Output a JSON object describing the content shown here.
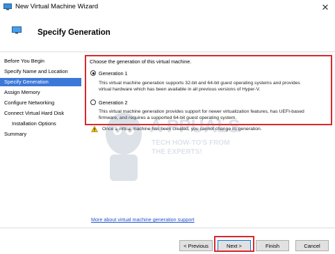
{
  "window": {
    "title": "New Virtual Machine Wizard",
    "close_glyph": "✕"
  },
  "header": {
    "title": "Specify Generation",
    "icon": "monitor-icon"
  },
  "nav": {
    "items": [
      {
        "label": "Before You Begin",
        "active": false
      },
      {
        "label": "Specify Name and Location",
        "active": false
      },
      {
        "label": "Specify Generation",
        "active": true
      },
      {
        "label": "Assign Memory",
        "active": false
      },
      {
        "label": "Configure Networking",
        "active": false
      },
      {
        "label": "Connect Virtual Hard Disk",
        "active": false
      },
      {
        "label": "Installation Options",
        "active": false,
        "sub": true
      },
      {
        "label": "Summary",
        "active": false
      }
    ]
  },
  "main": {
    "prompt": "Choose the generation of this virtual machine.",
    "options": [
      {
        "label": "Generation 1",
        "selected": true,
        "description_lines": [
          "This virtual machine generation supports 32-bit and 64-bit guest operating systems and provides",
          "virtual hardware which has been available in all previous versions of Hyper-V."
        ]
      },
      {
        "label": "Generation 2",
        "selected": false,
        "description_lines": [
          "This virtual machine generation provides support for newer virtualization features, has UEFI-based",
          "firmware, and requires a supported 64-bit guest operating system."
        ]
      }
    ],
    "warning": "Once a virtual machine has been created, you cannot change its generation.",
    "more_link": "More about virtual machine generation support"
  },
  "watermark": {
    "line1": "TECH HOW-TO'S FROM",
    "line2": "THE EXPERTS!"
  },
  "footer": {
    "previous_label": "< Previous",
    "next_label": "Next >",
    "finish_label": "Finish",
    "cancel_label": "Cancel"
  },
  "colors": {
    "highlight": "#d9262c",
    "nav_active": "#3b78d8",
    "link": "#2255cc"
  }
}
